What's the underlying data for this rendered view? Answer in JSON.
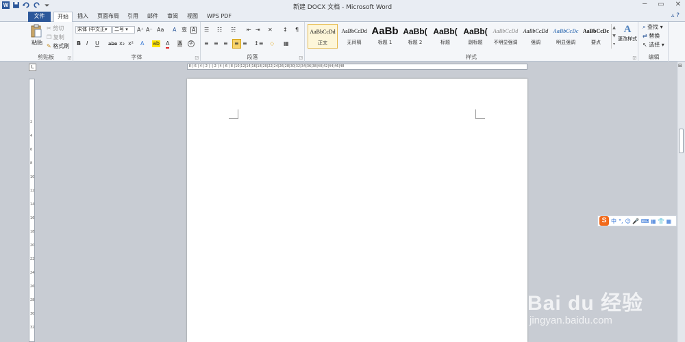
{
  "title_bar": {
    "title": "新建 DOCX 文档 - Microsoft Word",
    "app_logo": "W",
    "minimize": "─",
    "restore": "▭",
    "close": "✕"
  },
  "tabs": [
    {
      "label": "文件"
    },
    {
      "label": "开始"
    },
    {
      "label": "插入"
    },
    {
      "label": "页面布局"
    },
    {
      "label": "引用"
    },
    {
      "label": "邮件"
    },
    {
      "label": "审阅"
    },
    {
      "label": "视图"
    },
    {
      "label": "WPS PDF"
    }
  ],
  "clipboard": {
    "label": "剪贴板",
    "paste": "粘贴",
    "cut": "剪切",
    "copy": "复制",
    "format_painter": "格式刷"
  },
  "font": {
    "label": "字体",
    "family": "宋体 (中文正▾",
    "size": "二号",
    "bold": "B",
    "italic": "I",
    "underline": "U",
    "strike": "abe",
    "sub": "x₂",
    "sup": "x²",
    "grow": "A⁺",
    "shrink": "A⁻",
    "case": "Aa",
    "clear": "A",
    "text_effects": "A",
    "highlight": "ab",
    "color": "A",
    "char_shading": "A",
    "enclose": "字"
  },
  "paragraph": {
    "label": "段落",
    "bullets": "☰",
    "numbering": "☷",
    "multilevel": "☵",
    "decrease_indent": "⇤",
    "increase_indent": "⇥",
    "chinese_layout": "✕",
    "sort": "↕",
    "show_marks": "¶",
    "align_left": "≡",
    "center": "≡",
    "align_right": "≡",
    "justify": "≡",
    "distributed": "≡",
    "line_spacing": "↕≡",
    "shading": "◇",
    "borders": "▦"
  },
  "styles": {
    "label": "样式",
    "items": [
      {
        "preview": "AaBbCcDd",
        "name": "正文"
      },
      {
        "preview": "AaBbCcDd",
        "name": "无间隔"
      },
      {
        "preview": "AaBb",
        "name": "标题 1"
      },
      {
        "preview": "AaBb(",
        "name": "标题 2"
      },
      {
        "preview": "AaBb(",
        "name": "标题"
      },
      {
        "preview": "AaBb(",
        "name": "副标题"
      },
      {
        "preview": "AaBbCcDd",
        "name": "不明显强调"
      },
      {
        "preview": "AaBbCcDd",
        "name": "强调"
      },
      {
        "preview": "AaBbCcDc",
        "name": "明显强调"
      },
      {
        "preview": "AaBbCcDc",
        "name": "要点"
      }
    ],
    "change_styles": "更改样式"
  },
  "editing": {
    "label": "编辑",
    "find": "查找 ▾",
    "replace": "替换",
    "select": "选择 ▾"
  },
  "ruler": {
    "hmarks": "·8·|·6·|·4·|·2·|··|·2·|·4·|·6·|·8·|10|12|14|16|18|20|22|24|26|28|30|32|34|36|38|40|42|44|46|48",
    "vmarks": [
      "2",
      "4",
      "6",
      "8",
      "10",
      "12",
      "14",
      "16",
      "18",
      "20",
      "22",
      "24",
      "26",
      "28",
      "30",
      "32"
    ]
  },
  "ime": {
    "logo": "S",
    "mode": "中",
    "punct": "°,",
    "icons": "☺ 🎤 ⌨ ▦ 👕 ▦"
  },
  "watermark": {
    "brand": "Bai du 经验",
    "url": "jingyan.baidu.com"
  },
  "colors": {
    "file_tab": "#2b579a",
    "accent_highlight": "#e6b94a",
    "ime_logo": "#f26a1b"
  }
}
